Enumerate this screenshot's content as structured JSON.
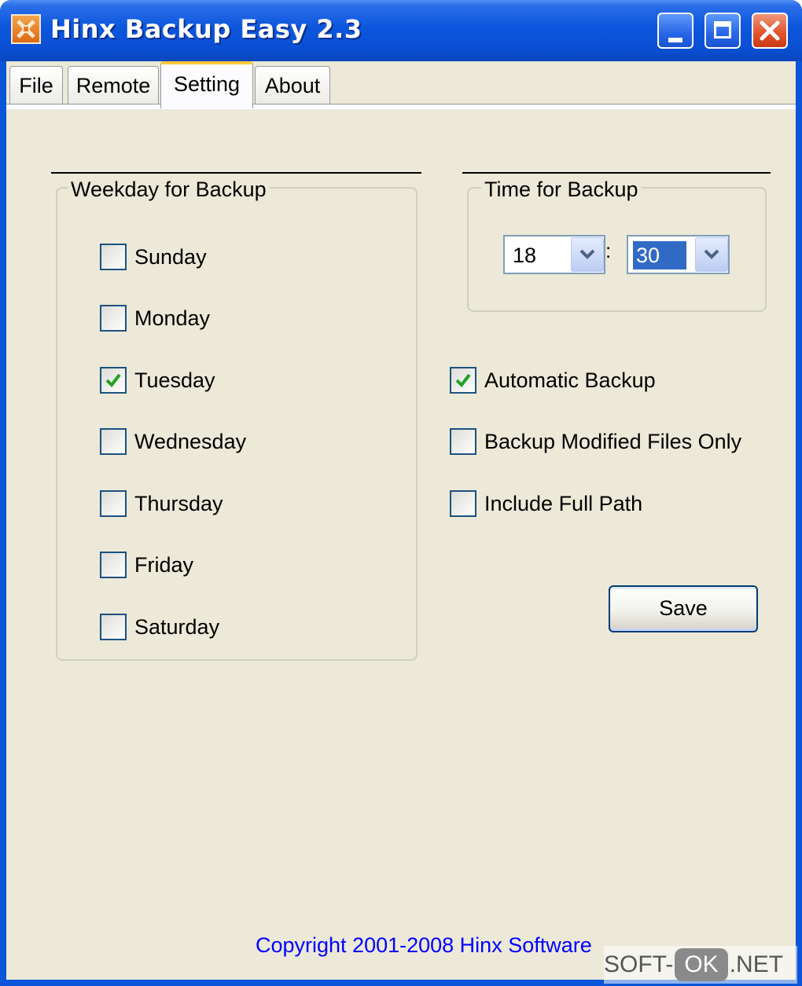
{
  "window": {
    "title": "Hinx Backup Easy 2.3"
  },
  "tabs": [
    {
      "label": "File"
    },
    {
      "label": "Remote"
    },
    {
      "label": "Setting",
      "active": true
    },
    {
      "label": "About"
    }
  ],
  "weekday_group": {
    "label": "Weekday for Backup",
    "days": [
      {
        "label": "Sunday",
        "checked": false
      },
      {
        "label": "Monday",
        "checked": false
      },
      {
        "label": "Tuesday",
        "checked": true
      },
      {
        "label": "Wednesday",
        "checked": false
      },
      {
        "label": "Thursday",
        "checked": false
      },
      {
        "label": "Friday",
        "checked": false
      },
      {
        "label": "Saturday",
        "checked": false
      }
    ]
  },
  "time_group": {
    "label": "Time for Backup",
    "hour": "18",
    "separator": ":",
    "minute": "30"
  },
  "options": [
    {
      "label": "Automatic Backup",
      "checked": true
    },
    {
      "label": "Backup Modified Files Only",
      "checked": false
    },
    {
      "label": "Include Full Path",
      "checked": false
    }
  ],
  "save_label": "Save",
  "copyright": "Copyright 2001-2008 Hinx Software",
  "watermark": {
    "left": "SOFT-",
    "mid": "OK",
    "right": ".NET"
  },
  "colors": {
    "titlebar": "#0a55d8",
    "face": "#ece9d8",
    "checkmark": "#21a121",
    "link": "#0000ff",
    "tab_highlight": "#ffc83c"
  }
}
